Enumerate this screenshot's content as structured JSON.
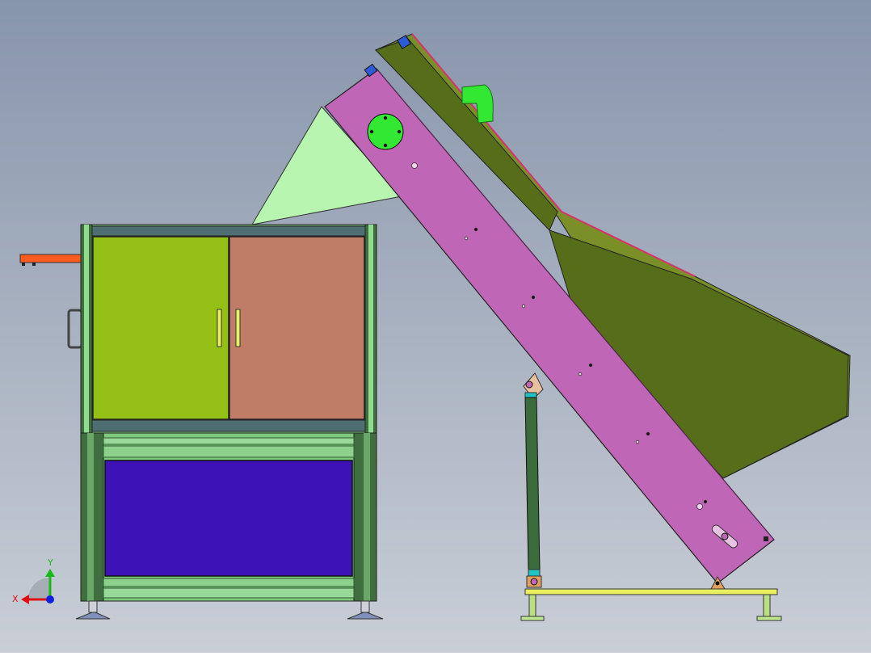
{
  "view": {
    "background_top": "#8795ab",
    "background_bottom": "#c9ced6"
  },
  "triad": {
    "x_label": "X",
    "y_label": "Y",
    "x_color": "#e01010",
    "y_color": "#18b818",
    "z_color": "#1020e0"
  },
  "colors": {
    "cabinet_frame": "#7fc97f",
    "cabinet_frame_dark": "#3f6f3f",
    "door_left": "#94bf15",
    "door_right": "#bf7c66",
    "lower_panel": "#3d12b6",
    "feed_plate": "#ff5a1f",
    "chute": "#b8f5b0",
    "conveyor_side": "#c066b6",
    "hopper_light": "#7b8f28",
    "hopper_dark": "#566e19",
    "motor": "#33e833",
    "cylinder": "#3b6b3b",
    "base_beam": "#e8f060",
    "feet": "#8090b8"
  }
}
